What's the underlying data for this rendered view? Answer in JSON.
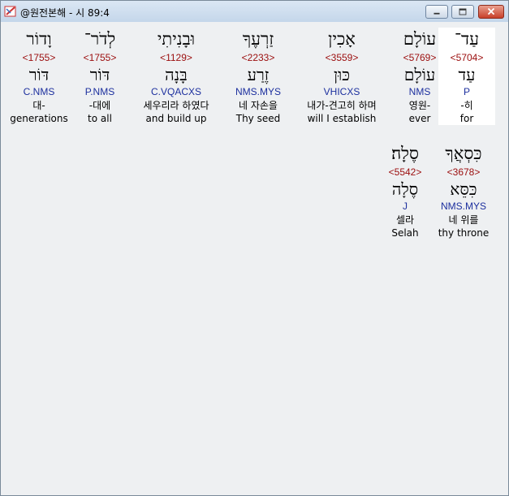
{
  "window": {
    "title": "@원전본해 - 시 89:4"
  },
  "words": [
    {
      "surface": "עַד־",
      "strong": "<5704>",
      "lemma": "עַד",
      "morph": "P",
      "korean": "-히",
      "english": "for",
      "selected": true
    },
    {
      "surface": "עוֹלָם",
      "strong": "<5769>",
      "lemma": "עוֹלָם",
      "morph": "NMS",
      "korean": "영원-",
      "english": "ever",
      "selected": false
    },
    {
      "surface": "אָכִין",
      "strong": "<3559>",
      "lemma": "כּוּן",
      "morph": "VHICXS",
      "korean": "내가-견고히 하며",
      "english": "will I establish",
      "selected": false
    },
    {
      "surface": "זַרְעֶךָ",
      "strong": "<2233>",
      "lemma": "זֶרַע",
      "morph": "NMS.MYS",
      "korean": "네 자손을",
      "english": "Thy seed",
      "selected": false
    },
    {
      "surface": "וּבָנִיתִי",
      "strong": "<1129>",
      "lemma": "בָּנָה",
      "morph": "C.VQACXS",
      "korean": "세우리라 하였다",
      "english": "and build up",
      "selected": false
    },
    {
      "surface": "לְדֹר־",
      "strong": "<1755>",
      "lemma": "דּוֹר",
      "morph": "P.NMS",
      "korean": "-대에",
      "english": "to all",
      "selected": false
    },
    {
      "surface": "וָדוֹר",
      "strong": "<1755>",
      "lemma": "דּוֹר",
      "morph": "C.NMS",
      "korean": "대-",
      "english": "generations",
      "selected": false
    },
    {
      "surface": "כִּסְאֲךָ",
      "strong": "<3678>",
      "lemma": "כִּסֵּא",
      "morph": "NMS.MYS",
      "korean": "네 위를",
      "english": "thy throne",
      "selected": false
    },
    {
      "surface": "סֶלָה׃",
      "strong": "<5542>",
      "lemma": "סֶלָה",
      "morph": "J",
      "korean": "셀라",
      "english": "Selah",
      "selected": false
    }
  ]
}
